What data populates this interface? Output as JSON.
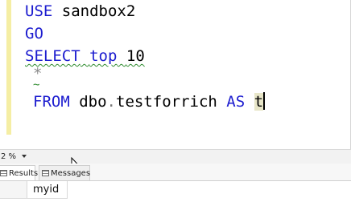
{
  "editor": {
    "lines": {
      "line1": {
        "kw": "USE",
        "rest": "sandbox2"
      },
      "line2": {
        "kw": "GO"
      },
      "line3": {
        "kw1": "SELECT",
        "kw2": "top",
        "num": "10"
      },
      "line4": {
        "star": "*"
      },
      "line5": {
        "kw": "FROM",
        "schema": "dbo",
        "dot": ".",
        "table": "testforrich",
        "as": "AS",
        "alias": "t"
      }
    }
  },
  "statusbar": {
    "zoom_value": "2 %"
  },
  "tabs": {
    "results_label": "Results",
    "messages_label": "Messages"
  },
  "grid": {
    "columns": [
      "myid"
    ]
  },
  "colors": {
    "keyword": "#1c1ccf",
    "squiggle": "#2e8b2e",
    "gutter_marker": "#f5eea4"
  }
}
